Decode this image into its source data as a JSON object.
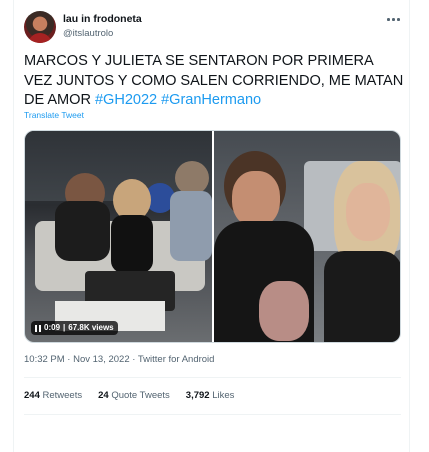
{
  "user": {
    "display_name": "lau in frodoneta",
    "handle": "@itslautrolo"
  },
  "tweet": {
    "text_plain": "MARCOS Y JULIETA SE SENTARON POR PRIMERA VEZ JUNTOS Y COMO SALEN CORRIENDO, ME MATAN DE AMOR ",
    "hashtags": [
      "#GH2022",
      "#GranHermano"
    ],
    "translate_label": "Translate Tweet",
    "timestamp": "10:32 PM · Nov 13, 2022 · Twitter for Android"
  },
  "video": {
    "time": "0:09",
    "views": "67.8K views"
  },
  "stats": {
    "retweets_count": "244",
    "retweets_label": "Retweets",
    "quotes_count": "24",
    "quotes_label": "Quote Tweets",
    "likes_count": "3,792",
    "likes_label": "Likes"
  },
  "colors": {
    "accent": "#1d9bf0",
    "text": "#0f1419",
    "secondary": "#536471"
  },
  "icons": [
    "more-icon",
    "pause-icon"
  ]
}
